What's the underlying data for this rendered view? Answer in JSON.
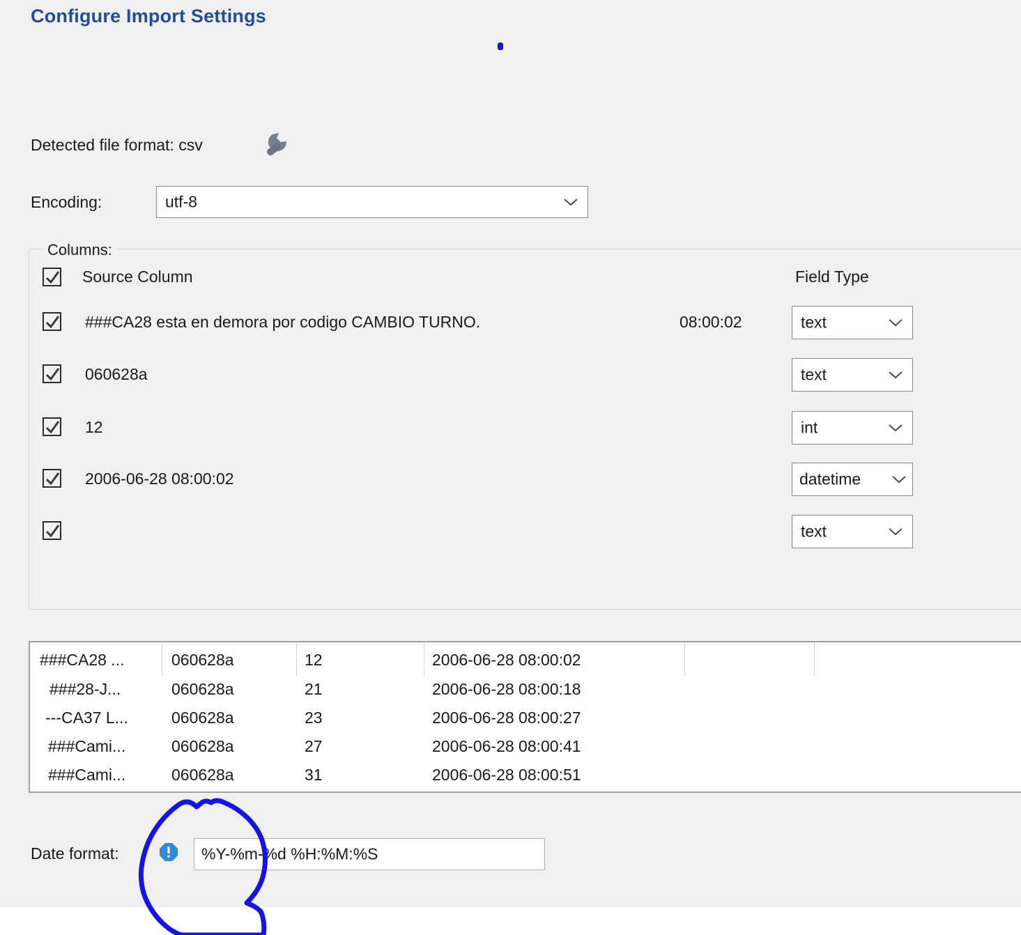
{
  "dialog": {
    "title": "Configure Import Settings",
    "detected_format_label": "Detected file format: csv",
    "wrench_icon": "wrench-icon",
    "encoding_label": "Encoding:",
    "encoding_value": "utf-8",
    "chevron_icon": "chevron-down-icon"
  },
  "columns_group": {
    "legend": "Columns:",
    "source_column_header": "Source Column",
    "field_type_header": "Field Type",
    "header_checked": true,
    "rows": [
      {
        "checked": true,
        "source": "###CA28 esta en demora por codigo CAMBIO TURNO.",
        "extra": "08:00:02",
        "type": "text"
      },
      {
        "checked": true,
        "source": "060628a",
        "extra": "",
        "type": "text"
      },
      {
        "checked": true,
        "source": "12",
        "extra": "",
        "type": "int"
      },
      {
        "checked": true,
        "source": "2006-06-28 08:00:02",
        "extra": "",
        "type": "datetime"
      },
      {
        "checked": true,
        "source": "",
        "extra": "",
        "type": "text"
      }
    ]
  },
  "preview": {
    "rows": [
      [
        "###CA28 ...",
        "060628a",
        "12",
        "2006-06-28 08:00:02",
        "",
        ""
      ],
      [
        "###28-J...",
        "060628a",
        "21",
        "2006-06-28 08:00:18",
        "",
        ""
      ],
      [
        "---CA37 L...",
        "060628a",
        "23",
        "2006-06-28 08:00:27",
        "",
        ""
      ],
      [
        "###Cami...",
        "060628a",
        "27",
        "2006-06-28 08:00:41",
        "",
        ""
      ],
      [
        "###Cami...",
        "060628a",
        "31",
        "2006-06-28 08:00:51",
        "",
        ""
      ]
    ]
  },
  "date_format": {
    "label": "Date format:",
    "info_icon": "info-icon",
    "value": "%Y-%m-%d %H:%M:%S"
  },
  "annotation": {
    "type": "hand-drawn-circle",
    "color": "#1414e6",
    "dot_color": "#1414e6"
  },
  "colors": {
    "dialog_bg": "#f0f0f0",
    "title_blue": "#1f4e9c",
    "annotation_blue": "#1414e6",
    "info_blue": "#2e8bd8",
    "field_bg": "#ffffff",
    "border_gray": "#828790"
  }
}
